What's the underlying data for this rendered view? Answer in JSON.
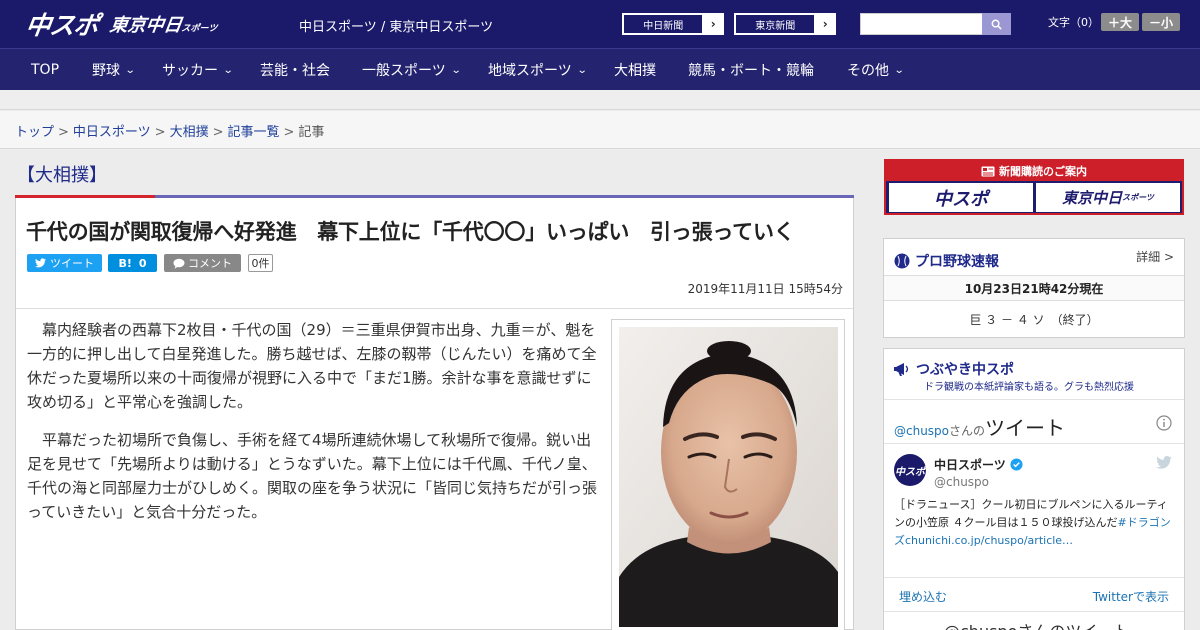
{
  "header": {
    "logo_main": "中スポ",
    "logo_sub": "東京中日",
    "logo_sub_small": "スポーツ",
    "site_title": "中日スポーツ / 東京中日スポーツ",
    "btn_chunichi": "中日新聞",
    "btn_tokyo": "東京新聞",
    "font_label": "文字（0）",
    "font_bigger": "＋大",
    "font_smaller": "－小"
  },
  "nav": {
    "items": [
      "TOP",
      "野球",
      "サッカー",
      "芸能・社会",
      "一般スポーツ",
      "地域スポーツ",
      "大相撲",
      "競馬・ボート・競輪",
      "その他"
    ]
  },
  "breadcrumb": {
    "top": "トップ",
    "chunichi": "中日スポーツ",
    "sumo": "大相撲",
    "list": "記事一覧",
    "current": "記事",
    "sep": ">"
  },
  "article": {
    "category": "【大相撲】",
    "headline": "千代の国が関取復帰へ好発進　幕下上位に「千代〇〇」いっぱい　引っ張っていく",
    "tweet_label": "ツイート",
    "hatena_label": "B!",
    "hatena_count": "0",
    "comment_label": "コメント",
    "comment_count": "0件",
    "date": "2019年11月11日 15時54分",
    "paragraphs": [
      "幕内経験者の西幕下2枚目・千代の国（29）＝三重県伊賀市出身、九重＝が、魁を一方的に押し出して白星発進した。勝ち越せば、左膝の靱帯（じんたい）を痛めて全休だった夏場所以来の十両復帰が視野に入る中で「まだ1勝。余計な事を意識せずに攻め切る」と平常心を強調した。",
      "平幕だった初場所で負傷し、手術を経て4場所連続休場して秋場所で復帰。鋭い出足を見せて「先場所よりは動ける」とうなずいた。幕下上位には千代鳳、千代ノ皇、千代の海と同部屋力士がひしめく。関取の座を争う状況に「皆同じ気持ちだが引っ張っていきたい」と気合十分だった。"
    ]
  },
  "sidebar": {
    "ad_title": "新聞購読のご案内",
    "ad_chuspo": "中スポ",
    "ad_tokyo": "東京中日",
    "ad_tokyo_small": "スポーツ",
    "baseball_title": "プロ野球速報",
    "baseball_detail": "詳細 >",
    "baseball_time": "10月23日21時42分現在",
    "baseball_score": "巨 ３ － ４ ソ　（終了）",
    "tweet_title": "つぶやき中スポ",
    "tweet_sub": "ドラ観戦の本紙評論家も語る。グラも熱烈応援",
    "tweet_account": "@chuspo",
    "tweet_san": "さんの",
    "tweet_word": "ツイート",
    "tw_name": "中日スポーツ",
    "tw_handle": "@chuspo",
    "tw_text": "［ドラニュース］クール初日にブルペンに入るルーティンの小笠原 ４クール目は１５０球投げ込んだ",
    "tw_link": "#ドラゴンズchunichi.co.jp/chuspo/article…",
    "tw_embed": "埋め込む",
    "tw_view": "Twitterで表示",
    "tw_footer": "@chuspoさんのツイート"
  },
  "colors": {
    "navy": "#1b1a6a",
    "nav": "#24236f",
    "red": "#d3252b",
    "twitter": "#1da1f2",
    "hatena": "#008fde",
    "comment": "#888888"
  }
}
